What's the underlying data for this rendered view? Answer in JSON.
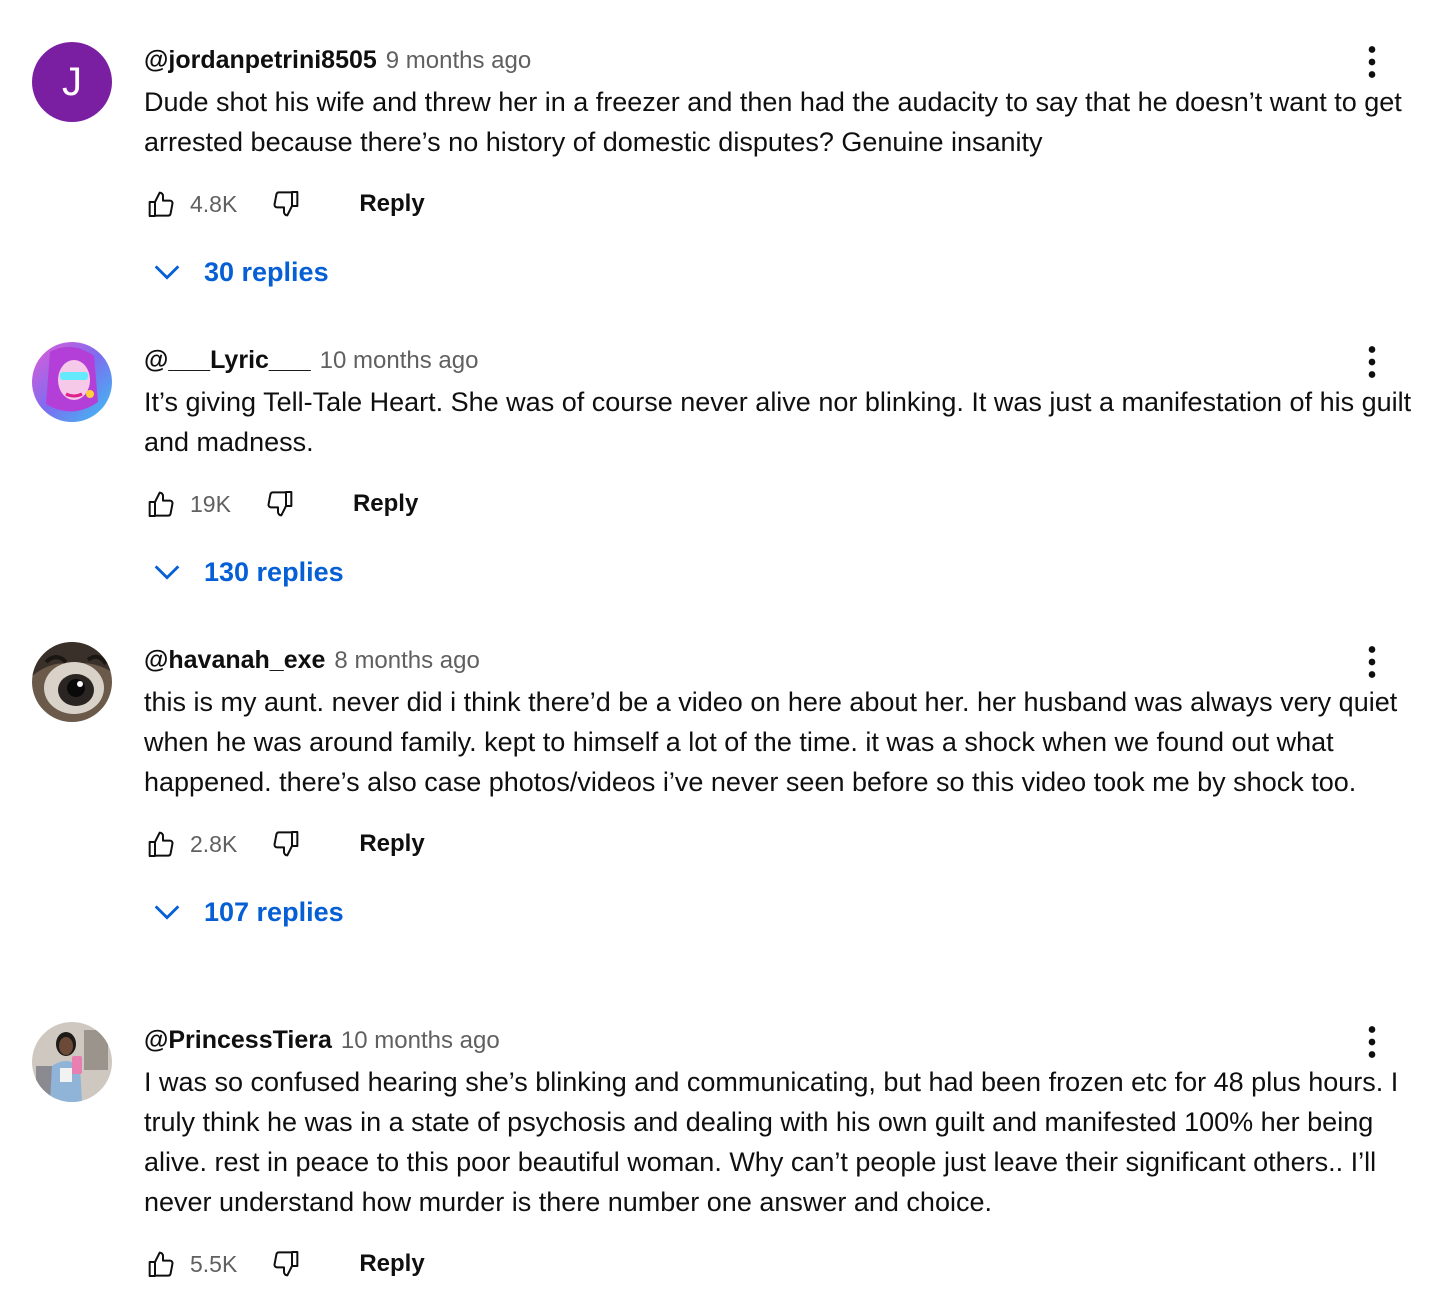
{
  "comments": [
    {
      "author": "@jordanpetrini8505",
      "time": "9 months ago",
      "text": "Dude shot his wife and threw her in a freezer and then had the audacity to say that he doesn’t want to get arrested because there’s no history of domestic disputes? Genuine insanity",
      "likes": "4.8K",
      "reply_label": "Reply",
      "replies_label": "30 replies",
      "avatar_letter": "J",
      "avatar_color": "#7b1fa2"
    },
    {
      "author": "@___Lyric___",
      "time": "10 months ago",
      "text": "It’s giving Tell-Tale Heart. She was of course never alive nor blinking. It was just a manifestation of his guilt and madness.",
      "likes": "19K",
      "reply_label": "Reply",
      "replies_label": "130 replies"
    },
    {
      "author": "@havanah_exe",
      "time": "8 months ago",
      "text": "this is my aunt. never did i think there’d be a video on here about her. her husband was always very quiet when he was around family. kept to himself a lot of the time. it was a shock when we found out what happened. there’s also case photos/videos i’ve never seen before so this video took me by shock too.",
      "likes": "2.8K",
      "reply_label": "Reply",
      "replies_label": "107 replies"
    },
    {
      "author": "@PrincessTiera",
      "time": "10 months ago",
      "text": "I was so confused hearing she’s blinking and communicating, but had been frozen etc for 48 plus hours. I truly think he was in a state of psychosis and dealing with his own guilt and manifested 100% her being alive. rest in peace to this poor beautiful woman. Why can’t people just leave their significant others.. I’ll never understand how murder is there number one answer and choice.",
      "likes": "5.5K",
      "reply_label": "Reply"
    }
  ],
  "colors": {
    "link_blue": "#065fd4",
    "secondary_text": "#606060",
    "primary_text": "#0f0f0f"
  },
  "icons": [
    "thumb-up-icon",
    "thumb-down-icon",
    "chevron-down-icon",
    "more-vert-icon"
  ]
}
